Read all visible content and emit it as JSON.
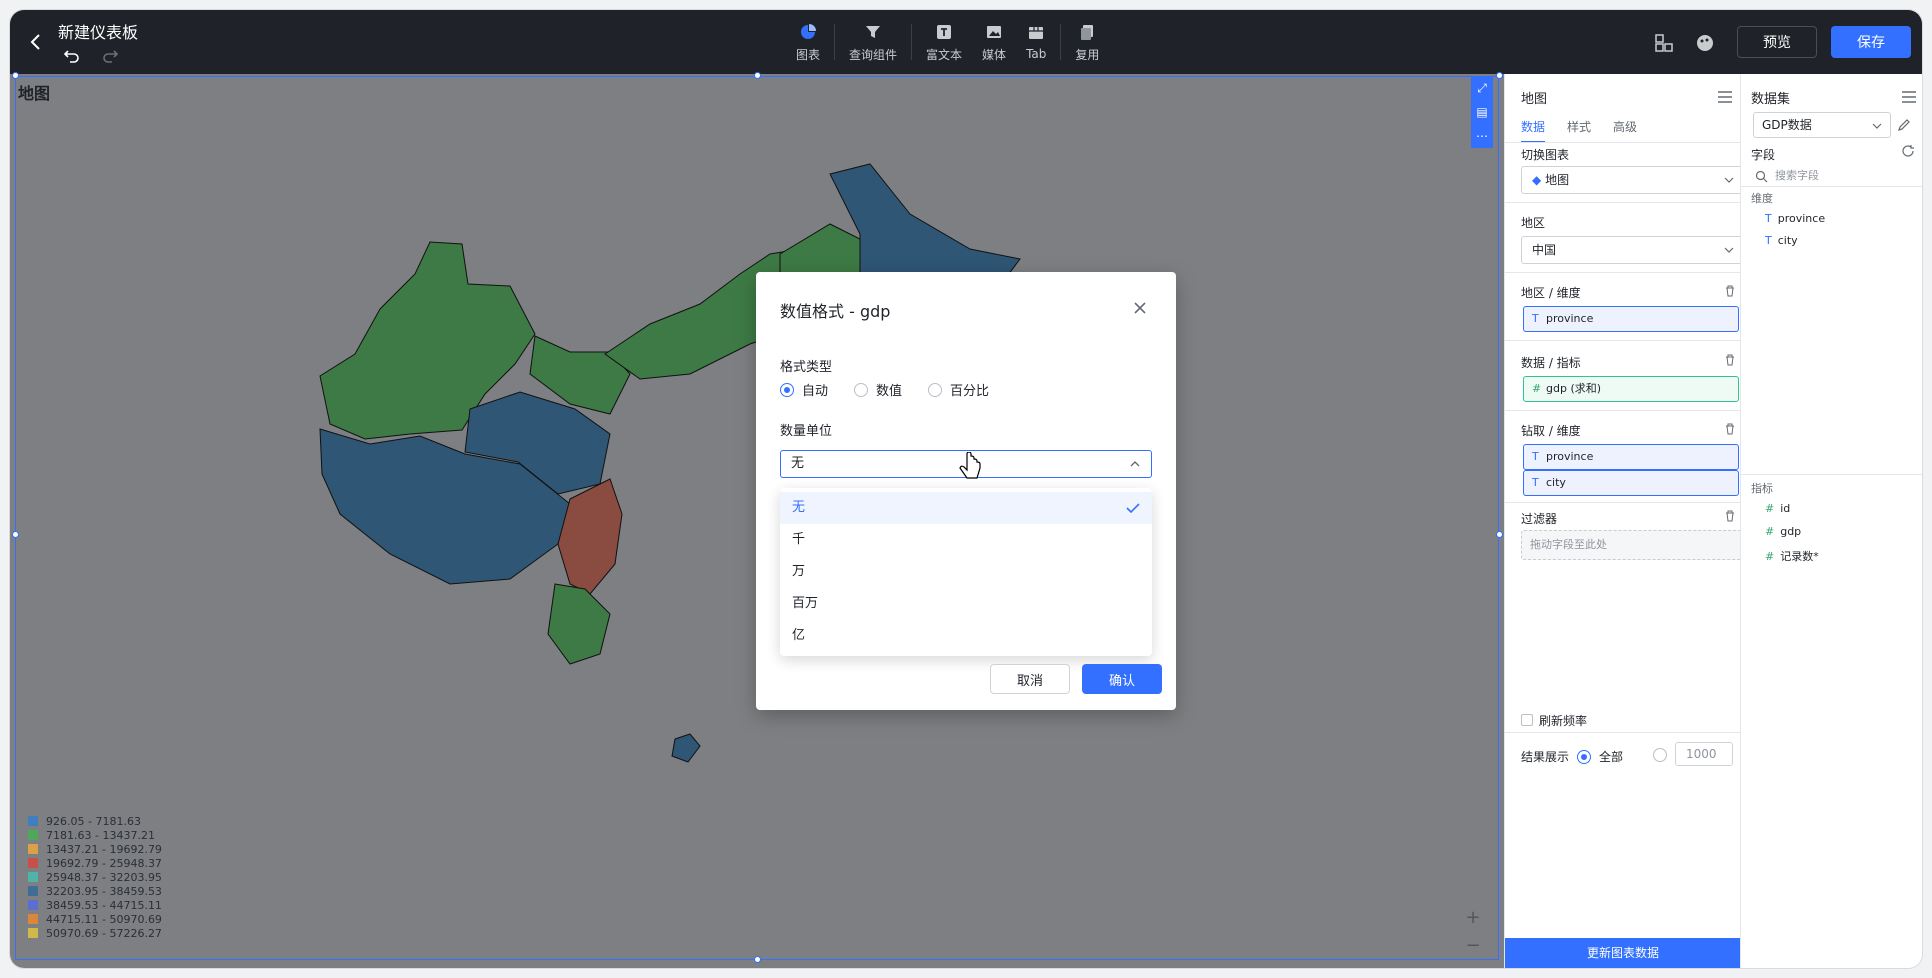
{
  "header": {
    "title": "新建仪表板",
    "tools": [
      {
        "label": "图表",
        "icon": "pie-chart-icon"
      },
      {
        "label": "查询组件",
        "icon": "filter-icon"
      },
      {
        "label": "富文本",
        "icon": "rich-text-icon"
      },
      {
        "label": "媒体",
        "icon": "media-icon"
      },
      {
        "label": "Tab",
        "icon": "tab-icon"
      },
      {
        "label": "复用",
        "icon": "reuse-icon"
      }
    ],
    "preview_label": "预览",
    "save_label": "保存"
  },
  "canvas": {
    "chart_title": "地图",
    "legend": [
      {
        "label": "926.05 - 7181.63",
        "color": "#3f7fc0"
      },
      {
        "label": "7181.63 - 13437.21",
        "color": "#4fa85a"
      },
      {
        "label": "13437.21 - 19692.79",
        "color": "#d9a24a"
      },
      {
        "label": "19692.79 - 25948.37",
        "color": "#c8504b"
      },
      {
        "label": "25948.37 - 32203.95",
        "color": "#4fb3a8"
      },
      {
        "label": "32203.95 - 38459.53",
        "color": "#3f6d96"
      },
      {
        "label": "38459.53 - 44715.11",
        "color": "#5a6fd0"
      },
      {
        "label": "44715.11 - 50970.69",
        "color": "#d9873a"
      },
      {
        "label": "50970.69 - 57226.27",
        "color": "#d1b84a"
      }
    ],
    "zoom_in": "+",
    "zoom_out": "−"
  },
  "modal": {
    "title": "数值格式 - gdp",
    "format_type_label": "格式类型",
    "format_options": [
      "自动",
      "数值",
      "百分比"
    ],
    "selected_format": "自动",
    "unit_label": "数量单位",
    "unit_value": "无",
    "unit_options": [
      "无",
      "千",
      "万",
      "百万",
      "亿"
    ],
    "cancel_label": "取消",
    "ok_label": "确认"
  },
  "config": {
    "title": "地图",
    "tabs": [
      "数据",
      "样式",
      "高级"
    ],
    "switch_chart_label": "切换图表",
    "chart_type": "地图",
    "region_label": "地区",
    "region_value": "中国",
    "region_dim_label": "地区 / 维度",
    "region_dim": "province",
    "metric_label": "数据 / 指标",
    "metric": "gdp (求和)",
    "drill_label": "钻取 / 维度",
    "drill_dims": [
      "province",
      "city"
    ],
    "filter_label": "过滤器",
    "filter_placeholder": "拖动字段至此处",
    "refresh_label": "刷新频率",
    "result_label": "结果展示",
    "result_all": "全部",
    "result_limit": "1000",
    "update_label": "更新图表数据"
  },
  "dataset": {
    "title": "数据集",
    "selected": "GDP数据",
    "fields_label": "字段",
    "search_placeholder": "搜索字段",
    "dimension_label": "维度",
    "dimensions": [
      "province",
      "city"
    ],
    "metric_label": "指标",
    "metrics": [
      "id",
      "gdp",
      "记录数*"
    ]
  }
}
